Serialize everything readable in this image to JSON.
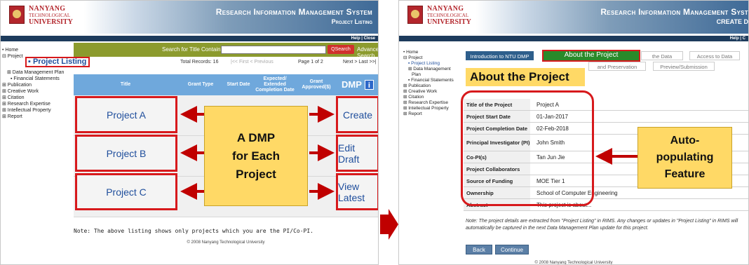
{
  "left": {
    "logo": {
      "line1": "NANYANG",
      "line2": "TECHNOLOGICAL",
      "line3": "UNIVERSITY"
    },
    "system": {
      "title": "Research Information Management System",
      "subtitle": "Project Listing"
    },
    "helpbar": "Help | Close",
    "nav": {
      "home": "• Home",
      "project": "⊟ Project",
      "project_listing": "▪ Project Listing",
      "data_mgmt": "⊞ Data Management Plan",
      "fin": "▪ Financial Statements",
      "publication": "⊞ Publication",
      "creative": "⊞ Creative Work",
      "citation": "⊞ Citation",
      "research": "⊞ Research Expertise",
      "ip": "⊞ Intellectual Property",
      "report": "⊞ Report"
    },
    "search": {
      "label": "Search for Title Containing",
      "button": "Search",
      "advanced": "Advanced Search"
    },
    "pager": {
      "total": "Total Records: 16",
      "nav": "|<< First < Previous",
      "page": "Page 1 of 2",
      "next": "Next > Last >>|"
    },
    "table": {
      "headers": [
        "Title",
        "Grant Type",
        "Start Date",
        "Expected/ Extended Completion Date",
        "Grant Approved($)",
        "DMP"
      ],
      "rows": [
        {
          "title": "Project A",
          "action": "Create"
        },
        {
          "title": "Project B",
          "action": "Edit Draft"
        },
        {
          "title": "Project C",
          "action": "View Latest"
        }
      ]
    },
    "callout": [
      "A DMP",
      "for Each",
      "Project"
    ],
    "note": "Note: The above listing shows only projects which you are the PI/Co-PI.",
    "copyright": "© 2008 Nanyang Technological University"
  },
  "right": {
    "logo": {
      "line1": "NANYANG",
      "line2": "TECHNOLOGICAL",
      "line3": "UNIVERSITY"
    },
    "system": {
      "title": "Research Information Management Syst",
      "subtitle": "CREATE D"
    },
    "helpbar": "Help | C",
    "nav": {
      "home": "• Home",
      "project": "⊟ Project",
      "project_listing": "▪ Project Listing",
      "data_mgmt": "⊞ Data Management",
      "data_mgmt2": "Plan",
      "fin": "▪ Financial Statements",
      "publication": "⊞ Publication",
      "creative": "⊞ Creative Work",
      "citation": "⊞ Citation",
      "research": "⊞ Research Expertise",
      "ip": "⊞ Intellectual Property",
      "report": "⊞ Report"
    },
    "steps": {
      "intro": "Introduction to NTU DMP",
      "about": "About the Project",
      "the_data": "the Data",
      "access": "Access to Data",
      "preservation": "and Preservation",
      "preview": "Preview/Submission"
    },
    "section_title": "About the Project",
    "fields": [
      {
        "label": "Title of the Project",
        "value": "Project A"
      },
      {
        "label": "Project Start Date",
        "value": "01-Jan-2017"
      },
      {
        "label": "Project Completion Date",
        "value": "02-Feb-2018"
      },
      {
        "label": "Principal Investigator (PI)",
        "value": "John Smith"
      },
      {
        "label": "Co-PI(s)",
        "value": "Tan Jun Jie"
      },
      {
        "label": "Project Collaborators",
        "value": ""
      },
      {
        "label": "Source of Funding",
        "value": "MOE Tier 1"
      },
      {
        "label": "Ownership",
        "value": "School of Computer Engineering"
      },
      {
        "label": "Abstract",
        "value": "This project is about..."
      }
    ],
    "callout": [
      "Auto-",
      "populating",
      "Feature"
    ],
    "note": "Note: The project details are extracted from \"Project Listing\" in RIMS. Any changes or updates in \"Project Listing\" in RIMS will automatically be captured in the next Data Management Plan update for this project.",
    "buttons": {
      "back": "Back",
      "continue": "Continue"
    },
    "copyright": "© 2008 Nanyang Technological University"
  },
  "colors": {
    "accent_red": "#d7191c",
    "callout_yellow": "#ffd966",
    "header_blue": "#6fa8dc",
    "search_olive": "#8c9b2e"
  }
}
